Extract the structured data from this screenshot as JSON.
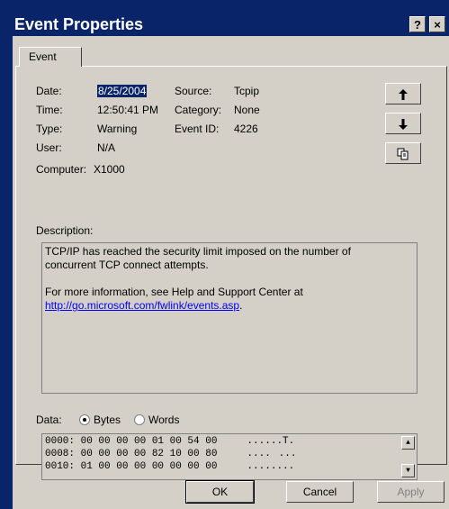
{
  "window": {
    "title": "Event Properties",
    "help_glyph": "?",
    "close_glyph": "×"
  },
  "tabs": [
    {
      "label": "Event"
    }
  ],
  "fields": {
    "date": {
      "label": "Date:",
      "value": "8/25/2004"
    },
    "time": {
      "label": "Time:",
      "value": "12:50:41 PM"
    },
    "type": {
      "label": "Type:",
      "value": "Warning"
    },
    "user": {
      "label": "User:",
      "value": "N/A"
    },
    "computer": {
      "label": "Computer:",
      "value": "X1000"
    },
    "source": {
      "label": "Source:",
      "value": "Tcpip"
    },
    "category": {
      "label": "Category:",
      "value": "None"
    },
    "event_id": {
      "label": "Event ID:",
      "value": "4226"
    }
  },
  "nav_icons": {
    "up": "up-arrow-icon",
    "down": "down-arrow-icon",
    "copy": "copy-icon"
  },
  "description": {
    "label": "Description:",
    "line1": "TCP/IP has reached the security limit imposed on the number of",
    "line2": "concurrent TCP connect attempts.",
    "line3": "For more information, see Help and Support Center at",
    "link": "http://go.microsoft.com/fwlink/events.asp",
    "link_suffix": "."
  },
  "data": {
    "label": "Data:",
    "bytes_label": "Bytes",
    "words_label": "Words",
    "selected": "Bytes",
    "rows": [
      "0000: 00 00 00 00 01 00 54 00     ......T.",
      "0008: 00 00 00 00 82 10 00 80     .......",
      "0010: 01 00 00 00 00 00 00 00     ........"
    ]
  },
  "buttons": {
    "ok": "OK",
    "cancel": "Cancel",
    "apply": "Apply"
  },
  "colors": {
    "titlebar": "#0a246a",
    "face": "#d4d0c8",
    "selection": "#0a246a",
    "link": "#0000ff"
  }
}
